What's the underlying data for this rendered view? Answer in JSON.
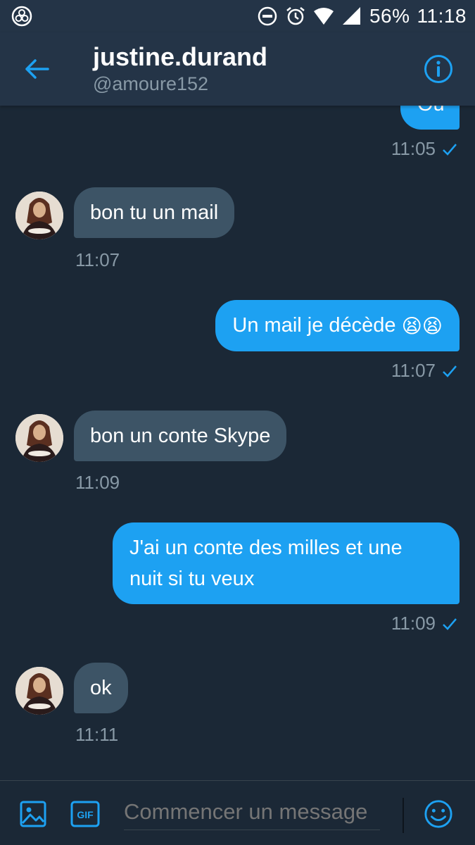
{
  "status_bar": {
    "battery": "56%",
    "time": "11:18"
  },
  "header": {
    "name": "justine.durand",
    "handle": "@amoure152"
  },
  "messages": [
    {
      "dir": "out",
      "text": "Ou",
      "time": "11:05"
    },
    {
      "dir": "in",
      "text": "bon tu un mail",
      "time": "11:07"
    },
    {
      "dir": "out",
      "text": "Un mail je décède",
      "emoji": "😫😫",
      "time": "11:07"
    },
    {
      "dir": "in",
      "text": "bon un conte Skype",
      "time": "11:09"
    },
    {
      "dir": "out",
      "text_line1": "J'ai un conte des milles et une",
      "text_line2": "nuit si tu veux",
      "time": "11:09"
    },
    {
      "dir": "in",
      "text": "ok",
      "time": "11:11"
    }
  ],
  "composer": {
    "placeholder": "Commencer un message",
    "gif_label": "GIF"
  },
  "colors": {
    "background": "#1b2836",
    "header": "#243447",
    "accent": "#1da1f2",
    "incoming_bubble": "#3d5466",
    "secondary_text": "#8899a6"
  }
}
